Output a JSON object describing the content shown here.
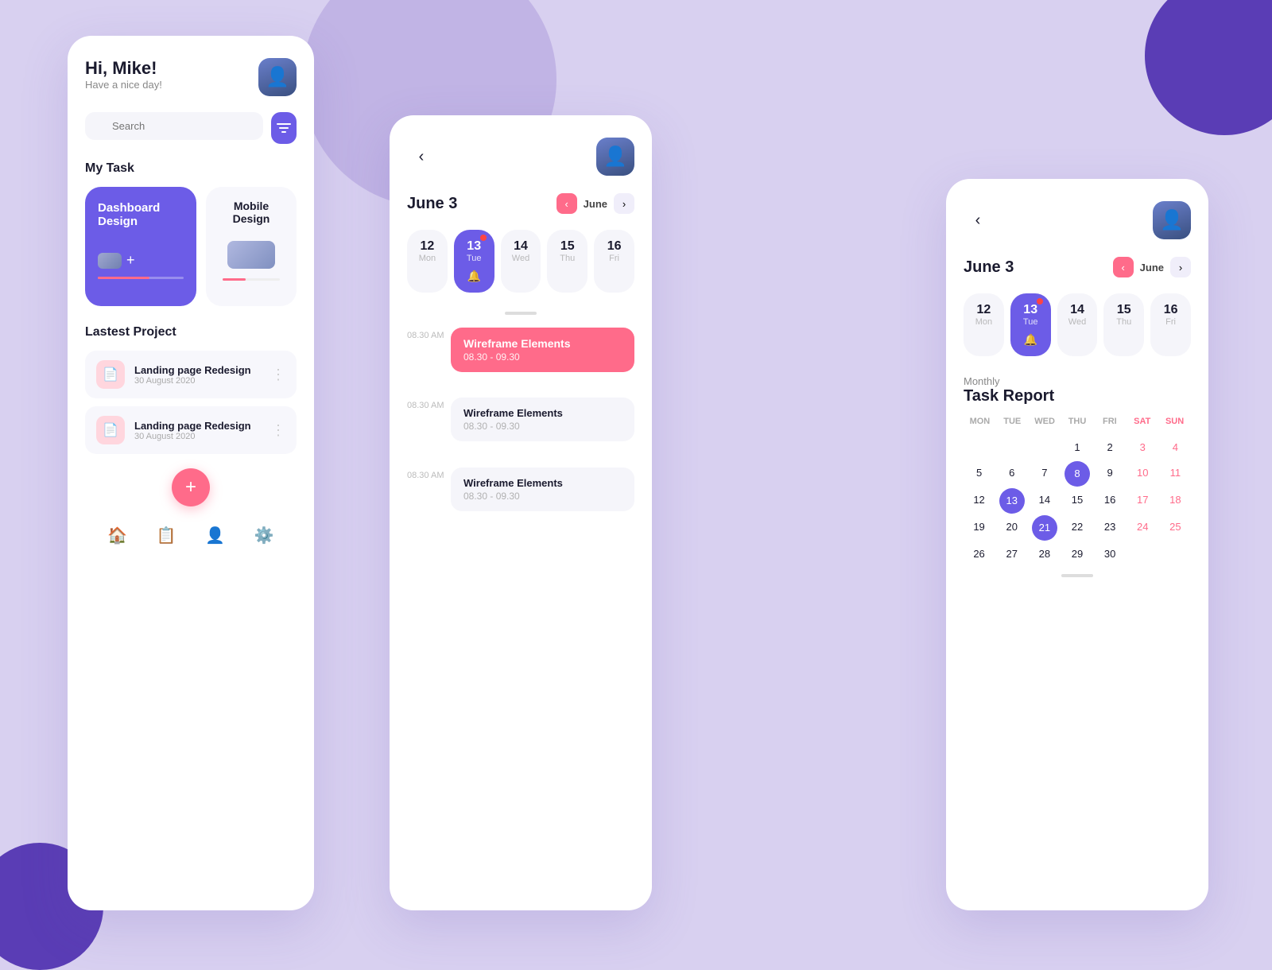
{
  "background": {
    "color": "#d8d0f0"
  },
  "card1": {
    "greeting": "Hi, Mike!",
    "subtitle": "Have a nice day!",
    "search_placeholder": "Search",
    "filter_icon": "⊞",
    "my_task_title": "My Task",
    "task1_name": "Dashboard Design",
    "task2_name": "Mobile Design",
    "latest_title": "Lastest Project",
    "projects": [
      {
        "name": "Landing page Redesign",
        "date": "30 August 2020"
      },
      {
        "name": "Landing page Redesign",
        "date": "30 August 2020"
      }
    ],
    "nav_items": [
      "home",
      "clipboard",
      "user",
      "gear"
    ]
  },
  "card2": {
    "date_heading": "June 3",
    "month_label": "June",
    "days": [
      {
        "num": "12",
        "name": "Mon",
        "active": false,
        "badge": false,
        "bell": false
      },
      {
        "num": "13",
        "name": "Tue",
        "active": true,
        "badge": true,
        "bell": true
      },
      {
        "num": "14",
        "name": "Wed",
        "active": false,
        "badge": false,
        "bell": false
      },
      {
        "num": "15",
        "name": "Thu",
        "active": false,
        "badge": false,
        "bell": false
      },
      {
        "num": "16",
        "name": "Fri",
        "active": false,
        "badge": false,
        "bell": false
      }
    ],
    "events": [
      {
        "time": "08.30 AM",
        "title": "Wireframe Elements",
        "range": "08.30 - 09.30",
        "style": "pink"
      },
      {
        "time": "08.30 AM",
        "title": "Wireframe Elements",
        "range": "08.30 - 09.30",
        "style": "plain"
      },
      {
        "time": "08.30 AM",
        "title": "Wireframe Elements",
        "range": "08.30 - 09.30",
        "style": "plain"
      }
    ]
  },
  "card3": {
    "date_heading": "June 3",
    "month_label": "June",
    "days": [
      {
        "num": "12",
        "name": "Mon",
        "active": false
      },
      {
        "num": "13",
        "name": "Tue",
        "active": true
      },
      {
        "num": "14",
        "name": "Wed",
        "active": false
      },
      {
        "num": "15",
        "name": "Thu",
        "active": false
      },
      {
        "num": "16",
        "name": "Fri",
        "active": false
      }
    ],
    "monthly_sub": "Monthly",
    "monthly_main": "Task Report",
    "cal_headers": [
      "MON",
      "TUE",
      "WED",
      "THU",
      "FRI",
      "SAT",
      "SUN"
    ],
    "cal_rows": [
      [
        "",
        "",
        "",
        "1",
        "2",
        "3",
        "4"
      ],
      [
        "5",
        "6",
        "7",
        "8",
        "9",
        "10",
        "11"
      ],
      [
        "12",
        "13",
        "14",
        "15",
        "16",
        "17",
        "18"
      ],
      [
        "19",
        "20",
        "21",
        "22",
        "23",
        "24",
        "25"
      ],
      [
        "26",
        "27",
        "28",
        "29",
        "30",
        "",
        ""
      ]
    ],
    "selected_cells": [
      "8",
      "13",
      "21"
    ],
    "weekend_cells": [
      "3",
      "4",
      "10",
      "11",
      "17",
      "18",
      "24",
      "25"
    ]
  }
}
